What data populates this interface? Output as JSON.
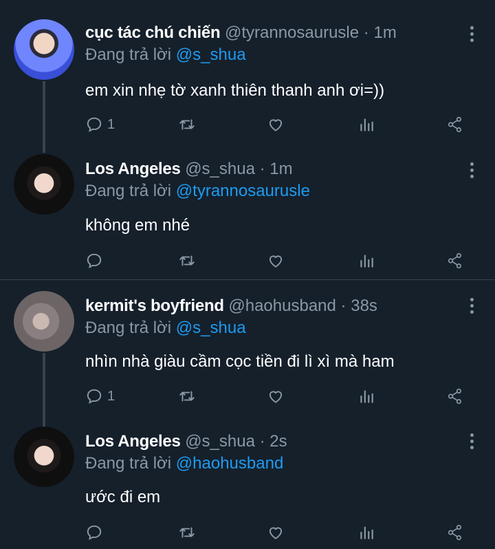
{
  "tweets": [
    {
      "name": "cục tác chú chiến",
      "handle": "@tyrannosaurusle",
      "dot": "·",
      "time": "1m",
      "reply_prefix": "Đang trả lời",
      "reply_to": "@s_shua",
      "text": "em xin nhẹ tờ xanh thiên thanh anh ơi=))",
      "reply_count": "1",
      "avatar": "avatar-blue-outfit"
    },
    {
      "name": "Los Angeles",
      "handle": "@s_shua",
      "dot": "·",
      "time": "1m",
      "reply_prefix": "Đang trả lời",
      "reply_to": "@tyrannosaurusle",
      "text": "không em nhé",
      "reply_count": "",
      "avatar": "avatar-deer-antlers"
    },
    {
      "name": "kermit's boyfriend",
      "handle": "@haohusband",
      "dot": "·",
      "time": "38s",
      "reply_prefix": "Đang trả lời",
      "reply_to": "@s_shua",
      "text": "nhìn nhà giàu cầm cọc tiền đi lì xì mà ham",
      "reply_count": "1",
      "avatar": "avatar-cat-blur"
    },
    {
      "name": "Los Angeles",
      "handle": "@s_shua",
      "dot": "·",
      "time": "2s",
      "reply_prefix": "Đang trả lời",
      "reply_to": "@haohusband",
      "text": "ước đi em",
      "reply_count": "",
      "avatar": "avatar-deer-antlers"
    }
  ],
  "colors": {
    "background": "#15202b",
    "text": "#ffffff",
    "muted": "#8b98a5",
    "link": "#1d9bf0",
    "divider": "#38444d"
  },
  "icons": [
    "reply-icon",
    "retweet-icon",
    "like-icon",
    "analytics-icon",
    "share-icon",
    "more-icon"
  ]
}
